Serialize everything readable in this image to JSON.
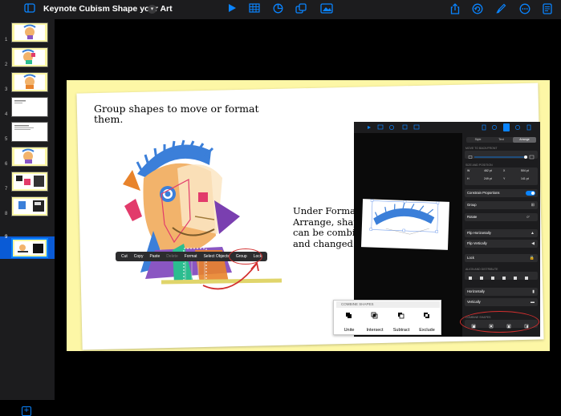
{
  "toolbar": {
    "title": "Keynote Cubism Shape your Art",
    "icons": [
      "sidebar-icon",
      "chevron-down-icon",
      "play-icon",
      "table-icon",
      "chart-icon",
      "shape-icon",
      "media-icon",
      "share-icon",
      "undo-icon",
      "format-brush-icon",
      "more-icon",
      "document-icon"
    ]
  },
  "navigator": {
    "slides": [
      "1",
      "2",
      "3",
      "4",
      "5",
      "6",
      "7",
      "8",
      "9"
    ],
    "selected": "9"
  },
  "slide": {
    "heading": "Group shapes to move or format them.",
    "body": "Under Format > Arrange, shapes can be combined and changed.",
    "context_menu": [
      "Cut",
      "Copy",
      "Paste",
      "Delete",
      "Format",
      "Select Objects",
      "Group",
      "Lock"
    ],
    "combine_panel": {
      "title": "COMBINE SHAPES",
      "items": [
        "Unite",
        "Intersect",
        "Subtract",
        "Exclude"
      ]
    }
  },
  "inset": {
    "tabs": [
      "Style",
      "Text",
      "Arrange"
    ],
    "sections": {
      "move": "MOVE TO BACK/FRONT",
      "size": "SIZE AND POSITION",
      "align": "ALIGN AND DISTRIBUTE",
      "combine": "COMBINE SHAPES"
    },
    "size_values": {
      "w": "462 pt",
      "h": "249 pt",
      "x": "504 pt",
      "y": "141 pt"
    },
    "rows": {
      "constrain": "Constrain Proportions",
      "group": "Group",
      "rotate": "Rotate",
      "rotate_value": "0°",
      "flip_h": "Flip Horizontally",
      "flip_v": "Flip Vertically",
      "lock": "Lock",
      "horizontally": "Horizontally",
      "vertically": "Vertically"
    }
  },
  "colors": {
    "accent": "#0a84ff",
    "annotation": "#d32f2f",
    "canvas": "#fdf7a6"
  }
}
